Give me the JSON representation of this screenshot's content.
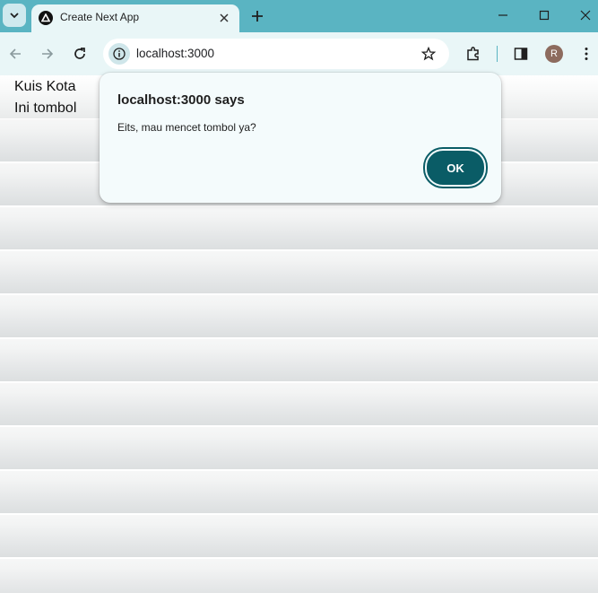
{
  "browser": {
    "tab": {
      "title": "Create Next App"
    },
    "address_bar": {
      "url": "localhost:3000"
    },
    "profile": {
      "initial": "R"
    },
    "colors": {
      "frame": "#5ab4c2",
      "toolbar": "#e9f6f7"
    }
  },
  "page": {
    "lines": [
      "Kuis Kota",
      "Ini tombol"
    ]
  },
  "alert": {
    "title": "localhost:3000 says",
    "message": "Eits, mau mencet tombol ya?",
    "ok_label": "OK",
    "button_color": "#0a5c66"
  },
  "icons": [
    "tab-search-icon",
    "nextjs-favicon-icon",
    "close-icon",
    "plus-icon",
    "minimize-icon",
    "maximize-icon",
    "window-close-icon",
    "back-arrow-icon",
    "forward-arrow-icon",
    "reload-icon",
    "site-info-icon",
    "star-icon",
    "extensions-icon",
    "side-panel-icon",
    "more-menu-icon"
  ]
}
